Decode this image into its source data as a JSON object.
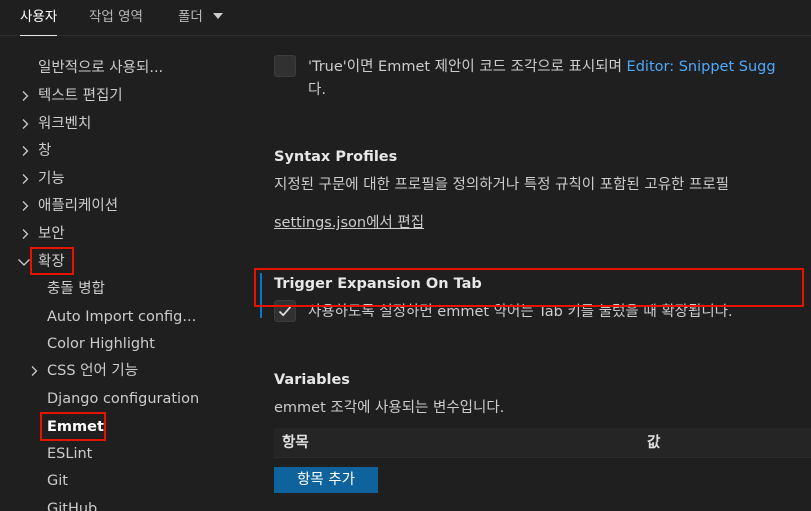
{
  "tabs": [
    {
      "label": "사용자"
    },
    {
      "label": "작업 영역"
    },
    {
      "label": "폴더"
    }
  ],
  "tree": {
    "items": [
      {
        "label": "일반적으로 사용되..."
      },
      {
        "label": "텍스트 편집기"
      },
      {
        "label": "워크벤치"
      },
      {
        "label": "창"
      },
      {
        "label": "기능"
      },
      {
        "label": "애플리케이션"
      },
      {
        "label": "보안"
      },
      {
        "label": "확장"
      },
      {
        "label": "충돌 병합"
      },
      {
        "label": "Auto Import config..."
      },
      {
        "label": "Color Highlight"
      },
      {
        "label": "CSS 언어 기능"
      },
      {
        "label": "Django configuration"
      },
      {
        "label": "Emmet"
      },
      {
        "label": "ESLint"
      },
      {
        "label": "Git"
      },
      {
        "label": "GitHub"
      }
    ]
  },
  "settings": {
    "snippet": {
      "text_line1": "'True'이면 Emmet 제안이 코드 조각으로 표시되며",
      "link": "Editor: Snippet Sugg",
      "text_line2": "다."
    },
    "syntax_profiles": {
      "title": "Syntax Profiles",
      "description": "지정된 구문에 대한 프로필을 정의하거나 특정 규칙이 포함된 고유한 프로필",
      "edit_link": "settings.json에서 편집"
    },
    "trigger_expansion": {
      "title": "Trigger Expansion On Tab",
      "description": "사용하도록 설정하면 emmet 약어는 Tab 키를 눌렀을 때 확장됩니다.",
      "checked": true
    },
    "variables": {
      "title": "Variables",
      "description": "emmet 조각에 사용되는 변수입니다.",
      "col_item": "항목",
      "col_value": "값",
      "add_button": "항목 추가"
    }
  },
  "colors": {
    "background": "#1f1f1f",
    "highlight_box": "#e51400",
    "link": "#4daafc",
    "button": "#0e639c",
    "focus_bar": "#0078d4"
  }
}
